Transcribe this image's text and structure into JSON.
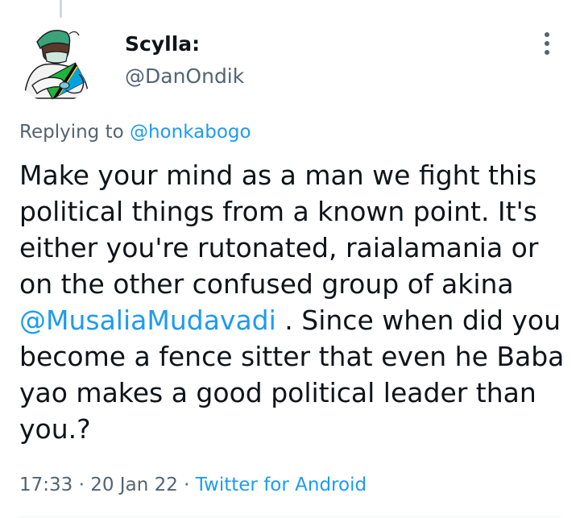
{
  "tweet": {
    "display_name": "Scylla:",
    "handle": "@DanOndik",
    "reply_prefix": "Replying to",
    "reply_handle": "@honkabogo",
    "lines": [
      "Make your mind as a man we fight this",
      "political things from a known point. It's",
      "either you're rutonated, raialamania or",
      "on the other confused group of akina"
    ],
    "mention": "@MusaliaMudavadi",
    "line5_rest": " . Since when did you",
    "lines_after": [
      "become a fence sitter that even he Baba",
      "yao makes a good political leader than",
      "you.?"
    ],
    "time": "17:33",
    "separator1": " · ",
    "date": "20 Jan 22",
    "separator2": " · ",
    "source": "Twitter for Android"
  },
  "icons": {
    "avatar": "doctor-hugging-flag-avatar",
    "more": "more-vertical-icon"
  },
  "colors": {
    "text": "#0f1419",
    "secondary": "#536471",
    "link": "#1d9bf0"
  }
}
